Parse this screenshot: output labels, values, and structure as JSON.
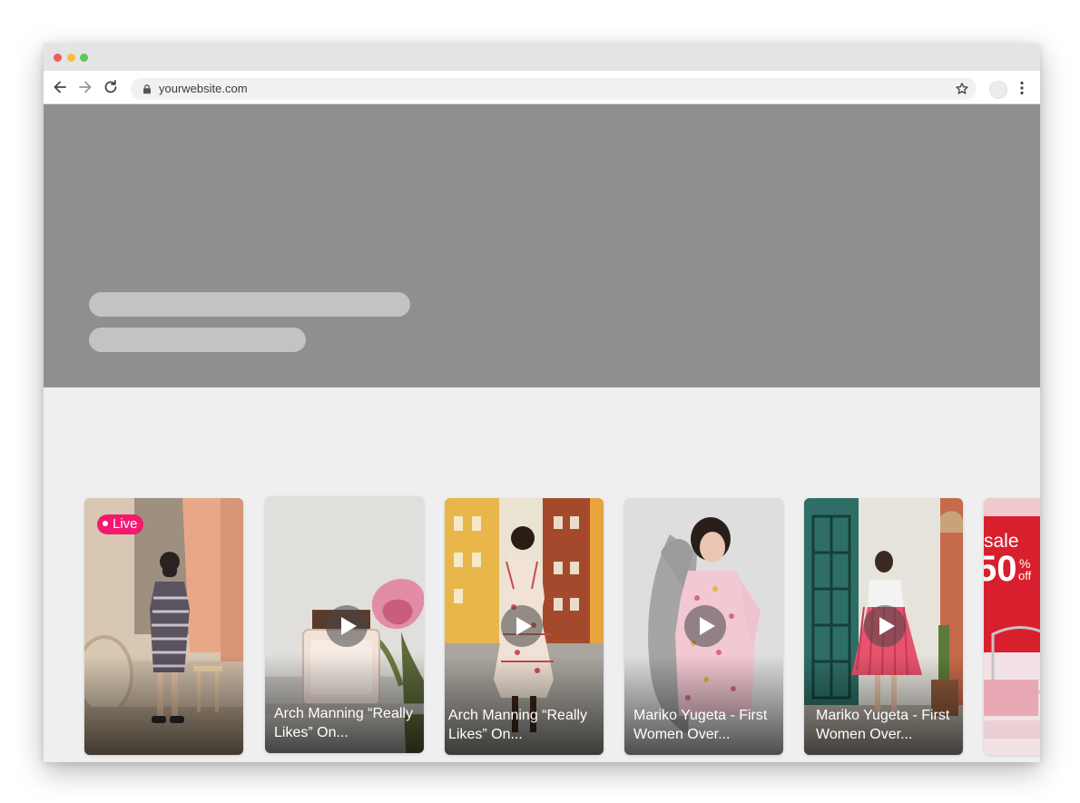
{
  "browser": {
    "url": "yourwebsite.com",
    "icons": {
      "back": "arrow-left-icon",
      "forward": "arrow-right-icon",
      "reload": "reload-icon",
      "lock": "lock-icon",
      "bookmark": "star-icon",
      "menu": "kebab-menu-icon"
    }
  },
  "hero": {
    "background": "#8f8f8f",
    "placeholder_bar_color": "#c3c3c3"
  },
  "carousel": {
    "accent": "#f2196f",
    "cards": [
      {
        "badge": "Live",
        "title": ""
      },
      {
        "badge": "",
        "title": "Arch Manning “Really Likes” On..."
      },
      {
        "badge": "",
        "title": "Arch Manning “Really Likes” On..."
      },
      {
        "badge": "",
        "title": "Mariko Yugeta - First Women Over..."
      },
      {
        "badge": "",
        "title": "Mariko Yugeta - First Women Over..."
      },
      {
        "badge": "",
        "title": "",
        "image_text_1": "sale",
        "image_text_2": "50",
        "image_text_3": "%",
        "image_text_4": "off"
      }
    ]
  }
}
